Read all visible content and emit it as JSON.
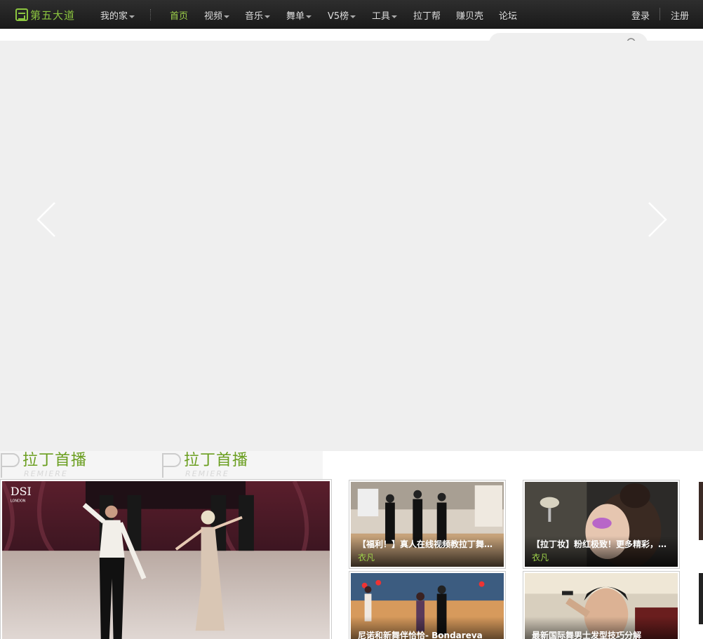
{
  "site": {
    "logo_text": "第五大道"
  },
  "nav": {
    "my_home": "我的家",
    "items": [
      {
        "label": "首页",
        "active": true
      },
      {
        "label": "视频",
        "dropdown": true
      },
      {
        "label": "音乐",
        "dropdown": true
      },
      {
        "label": "舞单",
        "dropdown": true
      },
      {
        "label": "V5榜",
        "dropdown": true
      },
      {
        "label": "工具",
        "dropdown": true
      },
      {
        "label": "拉丁帮"
      },
      {
        "label": "赚贝壳"
      },
      {
        "label": "论坛"
      }
    ],
    "login": "登录",
    "register": "注册"
  },
  "sections": [
    {
      "title": "拉丁首播",
      "subtitle": "REMIERE"
    },
    {
      "title": "拉丁首播",
      "subtitle": "REMIERE"
    }
  ],
  "cards": [
    {
      "caption": "",
      "author": "",
      "watermark": "DSI",
      "watermark_sub": "LONDON"
    },
    {
      "caption": "【福利！】真人在线视频教拉丁舞！...",
      "author": "衣凡"
    },
    {
      "caption": "【拉丁妆】粉红极致！更多精彩，关...",
      "author": "衣凡"
    },
    {
      "caption": "尼诺和新舞伴恰恰- Bondareva",
      "author": ""
    },
    {
      "caption": "最新国际舞男士发型技巧分解",
      "author": ""
    }
  ],
  "colors": {
    "accent": "#8cc63f",
    "nav_bg": "#1f1f1f",
    "banner_bg": "#efefef"
  },
  "icons": [
    "search-icon",
    "chevron-left-icon",
    "chevron-right-icon",
    "caret-down-icon"
  ]
}
